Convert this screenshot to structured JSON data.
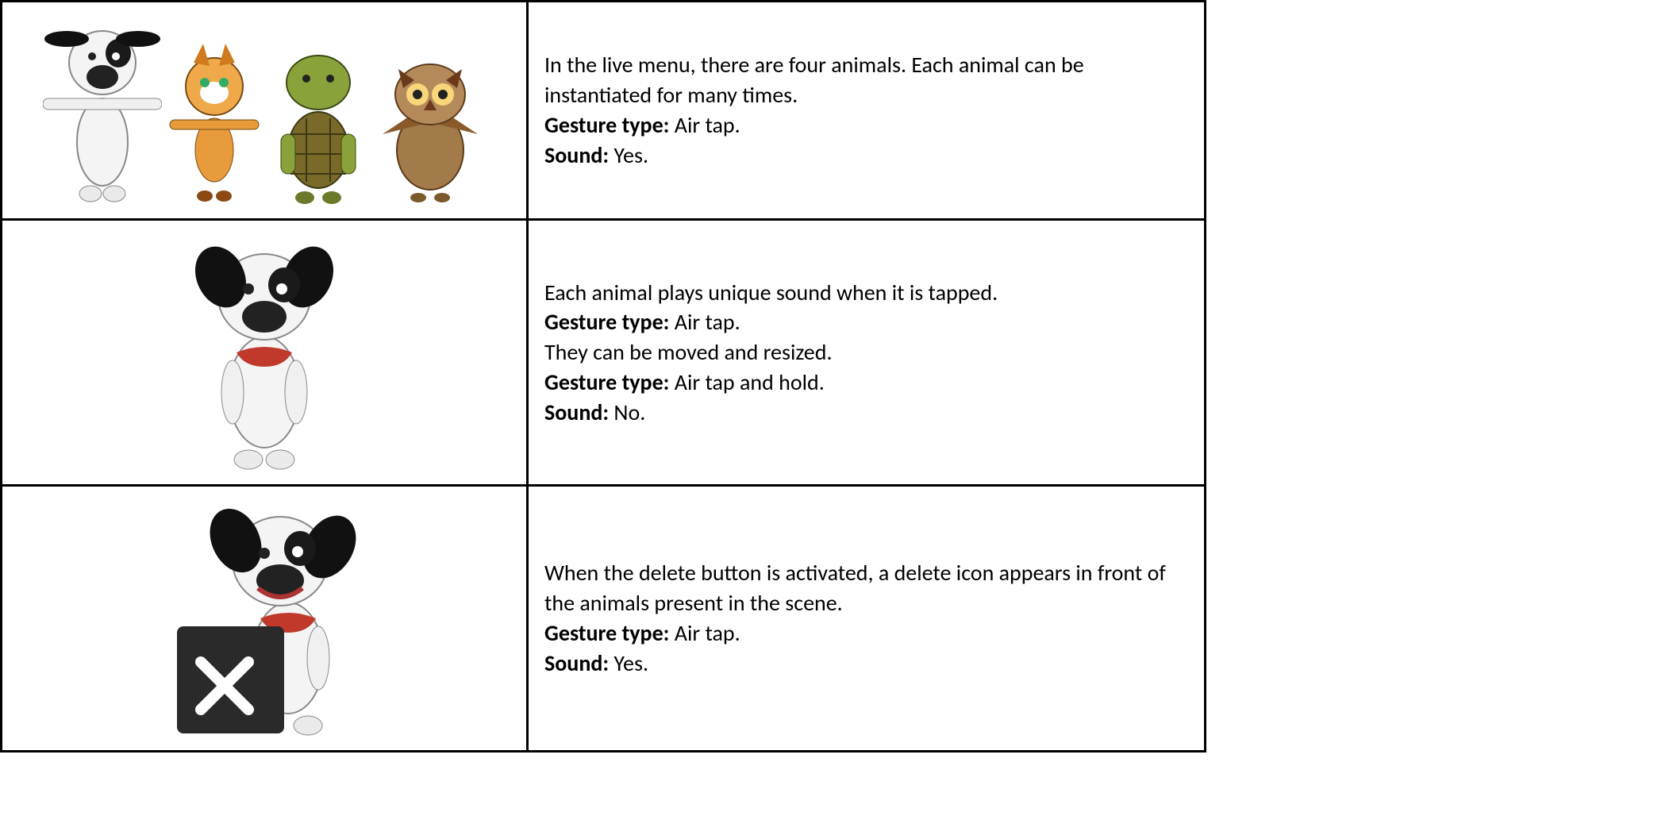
{
  "rows": [
    {
      "image_label": "Four cartoon animals: white dog with black ears and eye patch (T-pose), orange tabby cat (T-pose), green-brown turtle standing upright, brown owl.",
      "lines": [
        {
          "plain": "In the live menu, there are four animals. Each animal can be instantiated for many times."
        },
        {
          "bold": "Gesture type:",
          "rest": " Air tap."
        },
        {
          "bold": "Sound:",
          "rest": " Yes."
        }
      ]
    },
    {
      "image_label": "Single white cartoon dog with black ears, black nose, red collar, standing pose.",
      "lines": [
        {
          "plain": "Each animal plays unique sound when it is tapped."
        },
        {
          "bold": "Gesture type:",
          "rest": " Air tap."
        },
        {
          "plain": "They can be moved and resized."
        },
        {
          "bold": "Gesture type:",
          "rest": " Air tap and hold."
        },
        {
          "bold": "Sound:",
          "rest": " No."
        }
      ]
    },
    {
      "image_label": "White cartoon dog with black ears and red collar, smiling, with a dark square delete box showing a white X in front of it.",
      "lines": [
        {
          "plain": "When the delete button is activated, a delete icon appears in front of the animals present in the scene."
        },
        {
          "bold": "Gesture type:",
          "rest": " Air tap."
        },
        {
          "bold": "Sound:",
          "rest": " Yes."
        }
      ]
    }
  ]
}
